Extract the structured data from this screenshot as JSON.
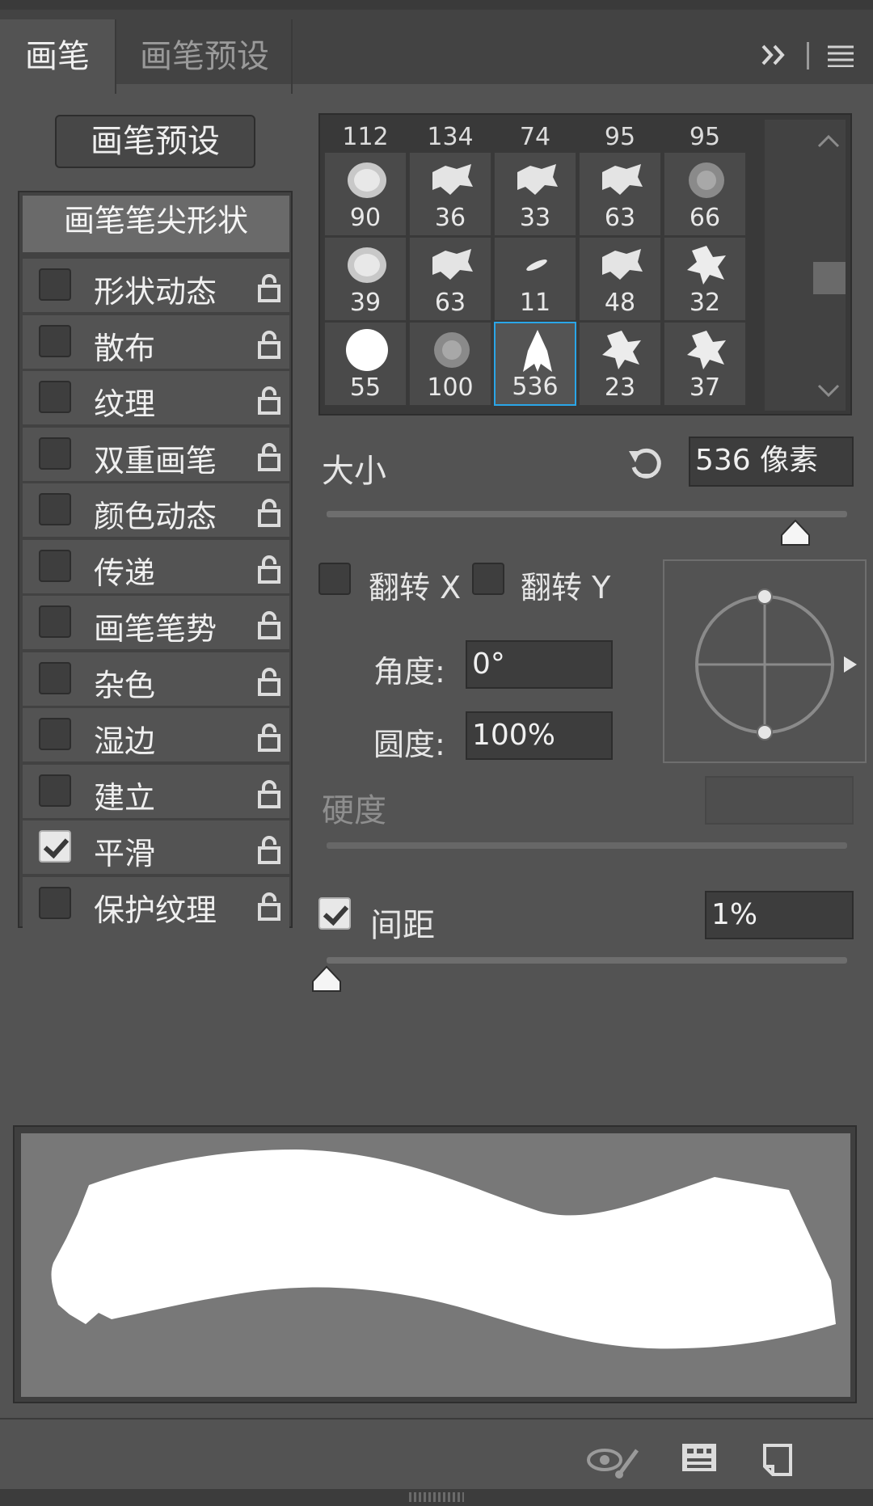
{
  "tabs": [
    {
      "label": "画笔",
      "active": true
    },
    {
      "label": "画笔预设",
      "active": false
    }
  ],
  "header_icons": [
    "expand-icon",
    "menu-icon"
  ],
  "left": {
    "preset_button": "画笔预设",
    "tip_shape": "画笔笔尖形状",
    "options": [
      {
        "label": "形状动态",
        "checked": false
      },
      {
        "label": "散布",
        "checked": false
      },
      {
        "label": "纹理",
        "checked": false
      },
      {
        "label": "双重画笔",
        "checked": false
      },
      {
        "label": "颜色动态",
        "checked": false
      },
      {
        "label": "传递",
        "checked": false
      },
      {
        "label": "画笔笔势",
        "checked": false
      },
      {
        "label": "杂色",
        "checked": false
      },
      {
        "label": "湿边",
        "checked": false
      },
      {
        "label": "建立",
        "checked": false
      },
      {
        "label": "平滑",
        "checked": true
      },
      {
        "label": "保护纹理",
        "checked": false
      }
    ]
  },
  "brush_grid": {
    "top_row": [
      "112",
      "134",
      "74",
      "95",
      "95"
    ],
    "rows": [
      [
        "90",
        "36",
        "33",
        "63",
        "66"
      ],
      [
        "39",
        "63",
        "11",
        "48",
        "32"
      ],
      [
        "55",
        "100",
        "536",
        "23",
        "37"
      ]
    ],
    "selected": "536"
  },
  "size": {
    "label": "大小",
    "value": "536 像素",
    "slider_fraction": 0.9
  },
  "flip": {
    "x_label": "翻转 X",
    "y_label": "翻转 Y",
    "x_checked": false,
    "y_checked": false
  },
  "angle": {
    "label": "角度:",
    "value": "0°"
  },
  "roundness": {
    "label": "圆度:",
    "value": "100%"
  },
  "hardness": {
    "label": "硬度",
    "value": ""
  },
  "spacing": {
    "label": "间距",
    "value": "1%",
    "checked": true,
    "slider_fraction": 0.0
  },
  "footer_icons": [
    "eye-brush-icon",
    "grid-icon",
    "new-brush-icon"
  ]
}
